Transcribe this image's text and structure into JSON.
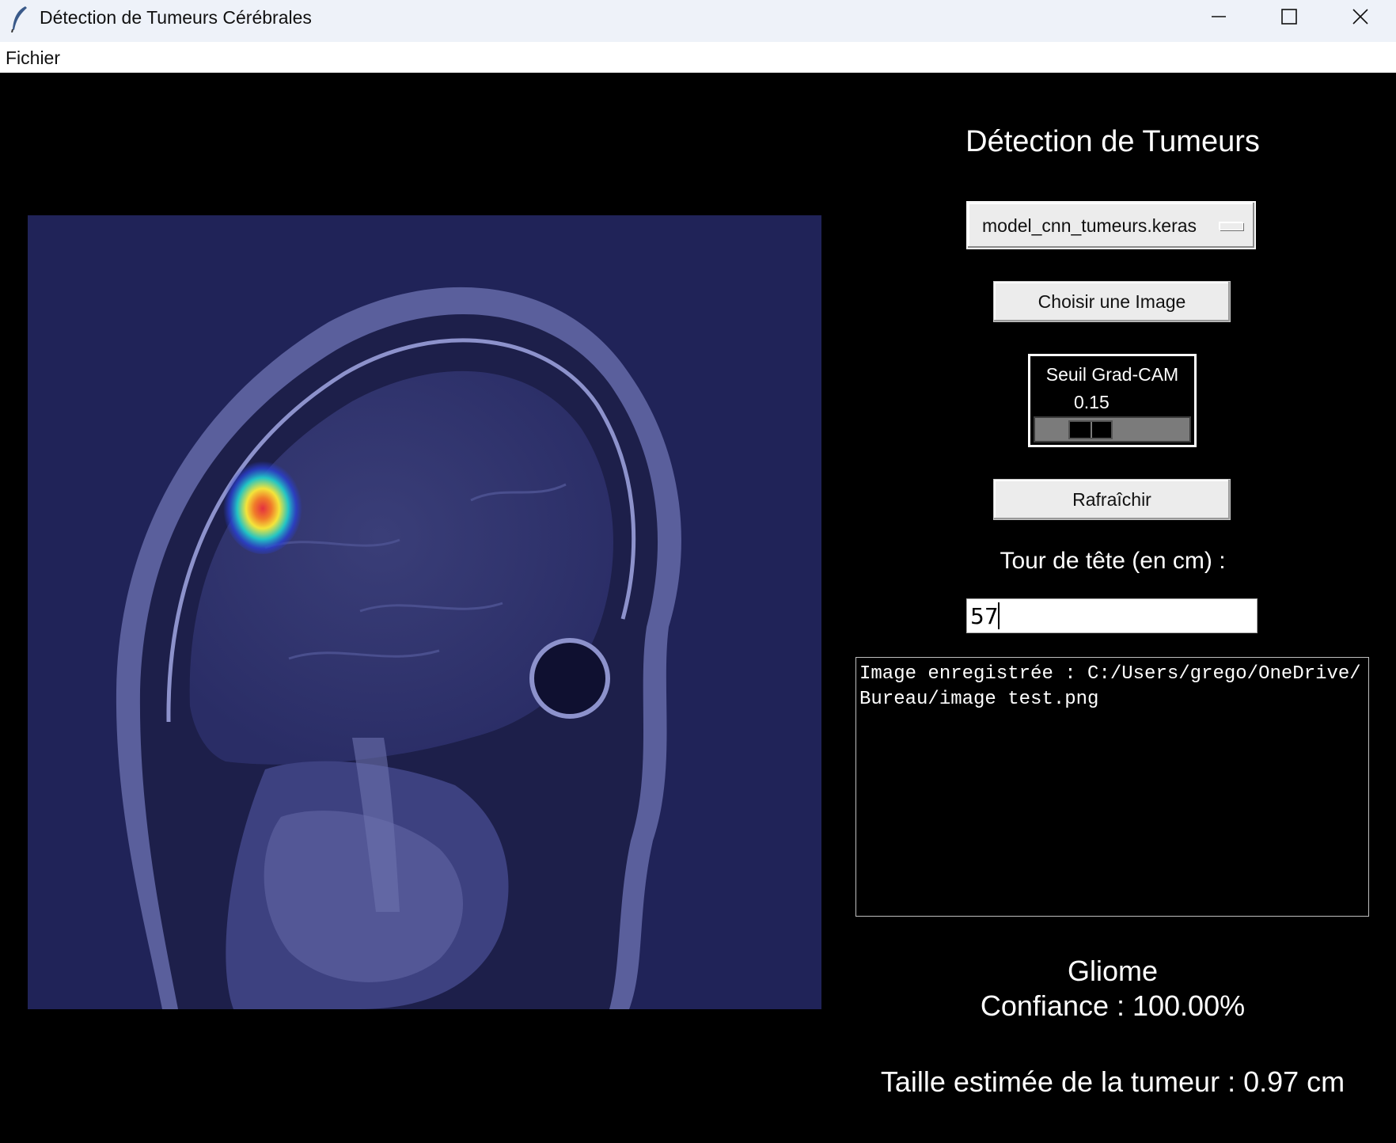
{
  "window": {
    "title": "Détection de Tumeurs Cérébrales",
    "app_icon": "feather-icon",
    "controls": [
      "minimize-icon",
      "maximize-icon",
      "close-icon"
    ]
  },
  "menu": {
    "items": [
      {
        "label": "Fichier"
      }
    ]
  },
  "panel": {
    "heading": "Détection de Tumeurs",
    "model_select": {
      "value": "model_cnn_tumeurs.keras"
    },
    "choose_image_label": "Choisir une Image",
    "gradcam_scale": {
      "label": "Seuil Grad-CAM",
      "value": "0.15",
      "level": 0.15
    },
    "refresh_label": "Rafraîchir",
    "head_size_label": "Tour de tête (en cm) :",
    "head_size_value": "57",
    "log_text": "Image enregistrée : C:/Users/grego/OneDrive/Bureau/image test.png",
    "result_class": "Gliome",
    "result_confidence": "Confiance : 100.00%",
    "result_tumor_size": "Taille estimée de la tumeur : 0.97 cm"
  },
  "colors": {
    "background": "#000000",
    "mri_tint": "#202358",
    "heatmap": [
      "#2a3fd0",
      "#22c4c4",
      "#f4e43a",
      "#f07a2a",
      "#e43040"
    ]
  }
}
